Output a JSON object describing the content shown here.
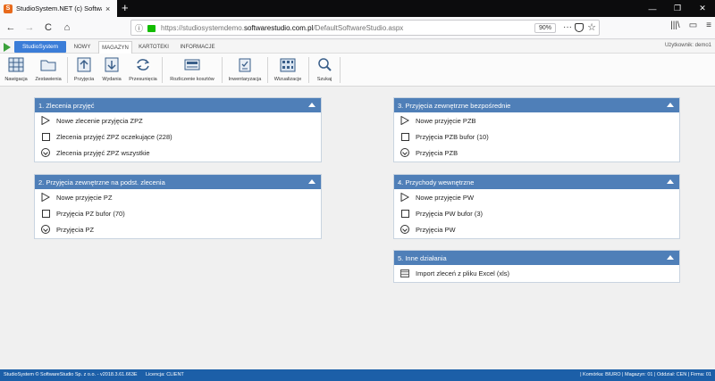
{
  "browser": {
    "tab_title": "StudioSystem.NET (c) Software",
    "tab_favicon": "S",
    "url_host_prefix": "https://studiosystemdemo.",
    "url_host_main": "softwarestudio.com.pl",
    "url_path": "/DefaultSoftwareStudio.aspx",
    "zoom": "90%",
    "new_tab": "+",
    "close_tab": "×",
    "menu_dots": "···",
    "star": "☆",
    "back": "←",
    "forward": "→",
    "reload": "C",
    "home": "⌂",
    "info": "ⓘ",
    "right_icons": [
      "|||\\",
      "▭",
      "≡"
    ],
    "window_buttons": [
      "—",
      "❐",
      "✕"
    ]
  },
  "appmenu": {
    "studio_label": "StudioSystem",
    "tabs": [
      "NOWY",
      "MAGAZYN",
      "KARTOTEKI",
      "INFORMACJE"
    ],
    "active_tab": "MAGAZYN",
    "user": "Użytkownik: demo1"
  },
  "toolbar": {
    "items": [
      {
        "label": "Nawigacja",
        "icon": "grid-icon"
      },
      {
        "label": "Zestawienia",
        "icon": "folder-icon"
      },
      {
        "label": "Przyjęcia",
        "icon": "arrow-up-icon"
      },
      {
        "label": "Wydania",
        "icon": "arrow-down-icon"
      },
      {
        "label": "Przesunięcia",
        "icon": "refresh-icon"
      },
      {
        "label": "Rozliczenie kosztów",
        "icon": "calculator-icon"
      },
      {
        "label": "Inwentaryzacja",
        "icon": "clipboard-icon"
      },
      {
        "label": "Wizualizacje",
        "icon": "warehouse-icon"
      },
      {
        "label": "Szukaj",
        "icon": "search-icon"
      }
    ]
  },
  "panels": {
    "p1": {
      "title": "1. Zlecenia przyjęć",
      "rows": [
        "Nowe zlecenie przyjęcia ZPZ",
        "Zlecenia przyjęć ZPZ oczekujące (228)",
        "Zlecenia przyjęć ZPZ wszystkie"
      ]
    },
    "p2": {
      "title": "2. Przyjęcia zewnętrzne na podst. zlecenia",
      "rows": [
        "Nowe przyjęcie PZ",
        "Przyjęcia PZ bufor (70)",
        "Przyjęcia PZ"
      ]
    },
    "p3": {
      "title": "3. Przyjęcia zewnętrzne bezpośrednie",
      "rows": [
        "Nowe przyjęcie PZB",
        "Przyjęcia PZB bufor (10)",
        "Przyjęcia PZB"
      ]
    },
    "p4": {
      "title": "4. Przychody wewnętrzne",
      "rows": [
        "Nowe przyjęcie PW",
        "Przyjęcia PW bufor (3)",
        "Przyjęcia PW"
      ]
    },
    "p5": {
      "title": "5. Inne działania",
      "rows": [
        "Import zleceń z pliku Excel (xls)"
      ]
    }
  },
  "statusbar": {
    "left": "StudioSystem © SoftwareStudio Sp. z o.o. - v2018.3.61.663E",
    "license": "Licencja: CLIENT",
    "right": "| Komórka: BIURO | Magazyn: 01 | Oddział: CEN | Firma: 01"
  },
  "colors": {
    "panel_header": "#4f7fb8",
    "statusbar": "#1c5fa8",
    "accent_button": "#3b7dd8"
  }
}
